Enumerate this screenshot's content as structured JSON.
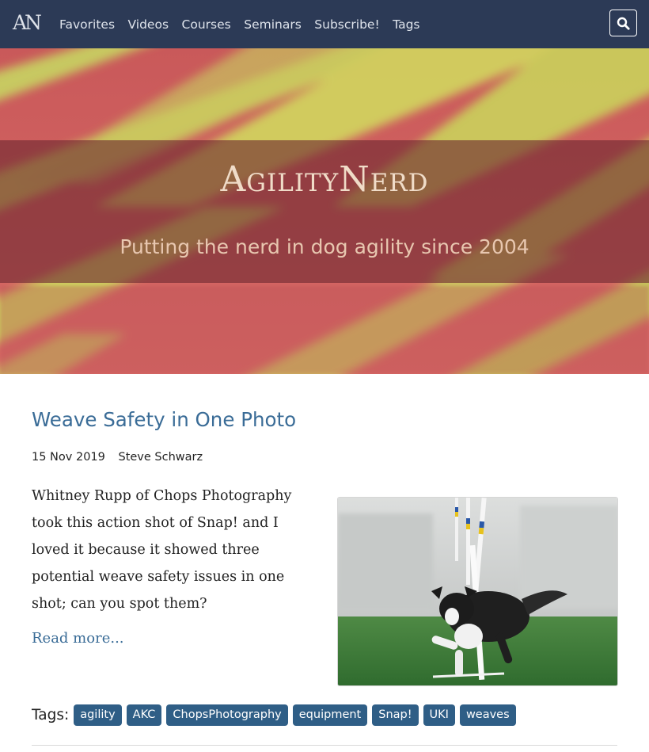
{
  "navbar": {
    "brand": "AN",
    "links": [
      "Favorites",
      "Videos",
      "Courses",
      "Seminars",
      "Subscribe!",
      "Tags"
    ],
    "search_icon": "search-icon",
    "background": "#2c3a56"
  },
  "hero": {
    "title": "AgilityNerd",
    "tagline": "Putting the nerd in dog agility since 2004"
  },
  "post": {
    "title": "Weave Safety in One Photo",
    "date": "15 Nov 2019",
    "author": "Steve Schwarz",
    "excerpt": "Whitney Rupp of Chops Photography took this action shot of Snap! and I loved it because it showed three potential weave safety issues in one shot; can you spot them?",
    "read_more": "Read more...",
    "tags_label": "Tags:",
    "tags": [
      "agility",
      "AKC",
      "ChopsPhotography",
      "equipment",
      "Snap!",
      "UKI",
      "weaves"
    ]
  },
  "colors": {
    "link": "#3a6c97",
    "tag_bg": "#2f5e86"
  }
}
